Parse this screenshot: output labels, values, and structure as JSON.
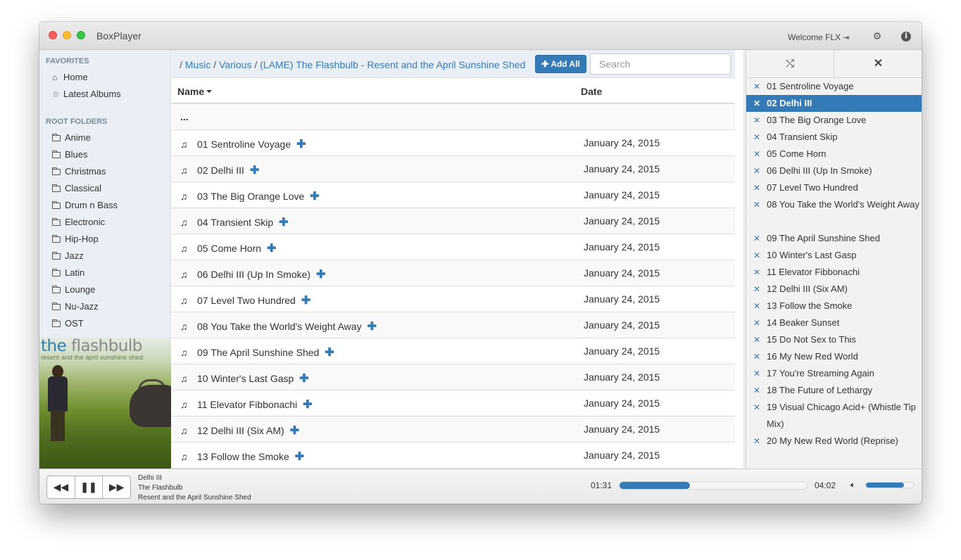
{
  "app": {
    "title": "BoxPlayer",
    "welcome": "Welcome FLX",
    "logout_icon": "sign-out-icon",
    "settings_icon": "gear-icon",
    "info_icon": "info-icon"
  },
  "sidebar": {
    "favorites_header": "FAVORITES",
    "favorites": [
      {
        "label": "Home",
        "icon": "home-icon"
      },
      {
        "label": "Latest Albums",
        "icon": "star-icon"
      }
    ],
    "root_folders_header": "ROOT FOLDERS",
    "folders": [
      "Anime",
      "Blues",
      "Christmas",
      "Classical",
      "Drum n Bass",
      "Electronic",
      "Hip-Hop",
      "Jazz",
      "Latin",
      "Lounge",
      "Nu-Jazz",
      "OST"
    ],
    "album_art": {
      "title_part1": "the ",
      "title_part2": "flashbulb",
      "subtitle": "resent and the april sunshine shed"
    }
  },
  "breadcrumb": {
    "root": "/",
    "parts": [
      "Music",
      "Various",
      "(LAME) The Flashbulb - Resent and the April Sunshine Shed"
    ],
    "sep": "/"
  },
  "toolbar": {
    "add_all_label": "Add All",
    "search_placeholder": "Search"
  },
  "table": {
    "columns": {
      "name": "Name",
      "date": "Date"
    },
    "parent_row": "...",
    "rows": [
      {
        "name": "01 Sentroline Voyage",
        "date": "January 24, 2015"
      },
      {
        "name": "02 Delhi III",
        "date": "January 24, 2015"
      },
      {
        "name": "03 The Big Orange Love",
        "date": "January 24, 2015"
      },
      {
        "name": "04 Transient Skip",
        "date": "January 24, 2015"
      },
      {
        "name": "05 Come Horn",
        "date": "January 24, 2015"
      },
      {
        "name": "06 Delhi III (Up In Smoke)",
        "date": "January 24, 2015"
      },
      {
        "name": "07 Level Two Hundred",
        "date": "January 24, 2015"
      },
      {
        "name": "08 You Take the World's Weight Away",
        "date": "January 24, 2015"
      },
      {
        "name": "09 The April Sunshine Shed",
        "date": "January 24, 2015"
      },
      {
        "name": "10 Winter's Last Gasp",
        "date": "January 24, 2015"
      },
      {
        "name": "11 Elevator Fibbonachi",
        "date": "January 24, 2015"
      },
      {
        "name": "12 Delhi III (Six AM)",
        "date": "January 24, 2015"
      },
      {
        "name": "13 Follow the Smoke",
        "date": "January 24, 2015"
      }
    ]
  },
  "playlist": {
    "shuffle_icon": "shuffle-icon",
    "clear_icon": "close-icon",
    "items": [
      "01 Sentroline Voyage",
      "02 Delhi III",
      "03 The Big Orange Love",
      "04 Transient Skip",
      "05 Come Horn",
      "06 Delhi III (Up In Smoke)",
      "07 Level Two Hundred",
      "08 You Take the World's Weight Away",
      "09 The April Sunshine Shed",
      "10 Winter's Last Gasp",
      "11 Elevator Fibbonachi",
      "12 Delhi III (Six AM)",
      "13 Follow the Smoke",
      "14 Beaker Sunset",
      "15 Do Not Sex to This",
      "16 My New Red World",
      "17 You're Streaming Again",
      "18 The Future of Lethargy",
      "19 Visual Chicago Acid+ (Whistle Tip Mix)",
      "20 My New Red World (Reprise)"
    ],
    "active_index": 1
  },
  "player": {
    "track": "Delhi III",
    "artist": "The Flashbulb",
    "album": "Resent and the April Sunshine Shed",
    "current_time": "01:31",
    "total_time": "04:02",
    "progress": 0.376,
    "volume": 0.8,
    "controls": {
      "prev_icon": "backward-icon",
      "pause_icon": "pause-icon",
      "next_icon": "forward-icon",
      "volume_icon": "volume-icon"
    },
    "accent": "#337ab7"
  }
}
